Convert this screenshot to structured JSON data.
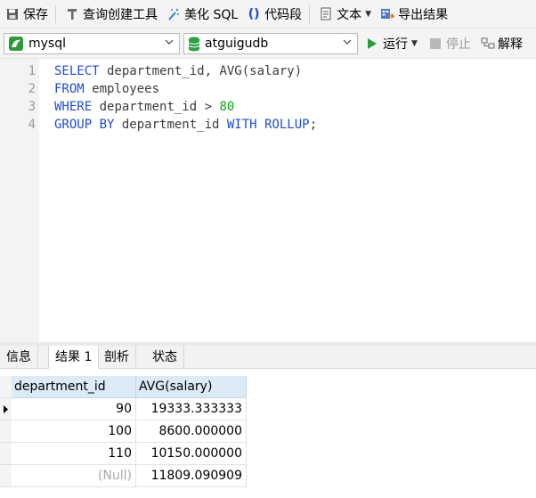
{
  "toolbar": {
    "save": "保存",
    "query_builder": "查询创建工具",
    "beautify": "美化 SQL",
    "snippet": "代码段",
    "text": "文本",
    "export": "导出结果"
  },
  "connection": {
    "server": "mysql",
    "database": "atguigudb",
    "run": "运行",
    "stop": "停止",
    "explain": "解释"
  },
  "editor": {
    "line_numbers": [
      "1",
      "2",
      "3",
      "4"
    ],
    "lines": [
      {
        "kw1": "SELECT",
        "t1": " department_id, AVG(salary)"
      },
      {
        "kw1": "FROM",
        "t1": " employees"
      },
      {
        "kw1": "WHERE",
        "t1": " department_id > ",
        "num": "80"
      },
      {
        "kw1": "GROUP BY",
        "t1": " department_id ",
        "kw2": "WITH ROLLUP",
        "t2": ";"
      }
    ]
  },
  "tabs": [
    "信息",
    "结果 1",
    "剖析",
    "状态"
  ],
  "results": {
    "columns": [
      "department_id",
      "AVG(salary)"
    ],
    "rows": [
      [
        "90",
        "19333.333333"
      ],
      [
        "100",
        "8600.000000"
      ],
      [
        "110",
        "10150.000000"
      ],
      [
        "(Null)",
        "11809.090909"
      ]
    ]
  },
  "colors": {
    "keyword": "#1f4bd2",
    "number": "#11a11a",
    "run_green": "#2e9b3a",
    "db_green": "#2ea043"
  }
}
